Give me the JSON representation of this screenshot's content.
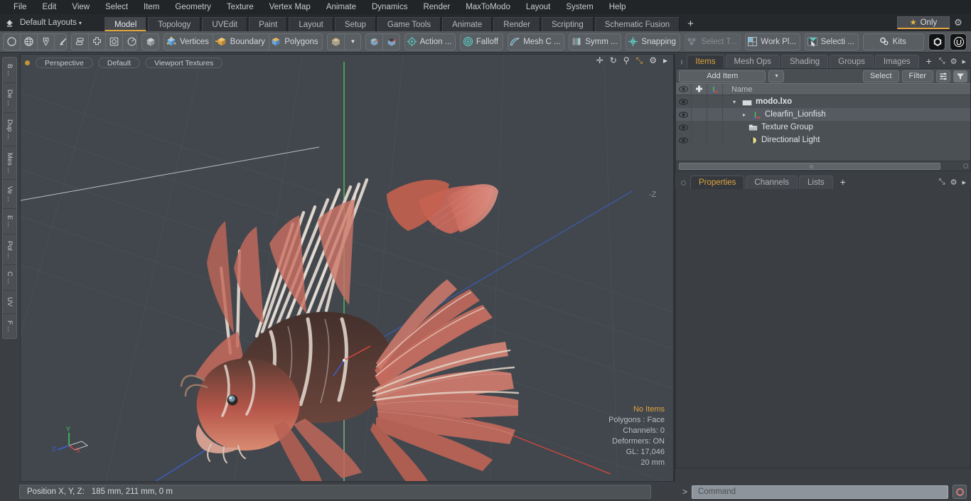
{
  "app": {
    "title": "Modo 3D Modeling Application",
    "accent": "#e0a33c",
    "panel_bg": "#3b3f44",
    "toolbar_bg": "#55595e"
  },
  "menubar": {
    "items": [
      {
        "label": "File"
      },
      {
        "label": "Edit"
      },
      {
        "label": "View"
      },
      {
        "label": "Select"
      },
      {
        "label": "Item"
      },
      {
        "label": "Geometry"
      },
      {
        "label": "Texture"
      },
      {
        "label": "Vertex Map"
      },
      {
        "label": "Animate"
      },
      {
        "label": "Dynamics"
      },
      {
        "label": "Render"
      },
      {
        "label": "MaxToModo"
      },
      {
        "label": "Layout"
      },
      {
        "label": "System"
      },
      {
        "label": "Help"
      }
    ]
  },
  "layoutbar": {
    "home_icon": "home-up-icon",
    "layouts_label": "Default Layouts",
    "caret": "▾",
    "tabs": [
      {
        "label": "Model",
        "active": true
      },
      {
        "label": "Topology",
        "active": false
      },
      {
        "label": "UVEdit",
        "active": false
      },
      {
        "label": "Paint",
        "active": false
      },
      {
        "label": "Layout",
        "active": false
      },
      {
        "label": "Setup",
        "active": false
      },
      {
        "label": "Game Tools",
        "active": false
      },
      {
        "label": "Animate",
        "active": false
      },
      {
        "label": "Render",
        "active": false
      },
      {
        "label": "Scripting",
        "active": false
      },
      {
        "label": "Schematic Fusion",
        "active": false
      }
    ],
    "add_tab_label": "+",
    "only_label": "Only",
    "star_icon": "star-icon",
    "gear_icon": "gear-icon"
  },
  "toolbar": {
    "groups": [
      {
        "name": "primitives",
        "buttons": [
          {
            "icon": "circle-icon",
            "label": ""
          },
          {
            "icon": "globe-icon",
            "label": ""
          },
          {
            "icon": "pen-icon",
            "label": ""
          },
          {
            "icon": "cone-arrow-icon",
            "label": ""
          }
        ]
      },
      {
        "name": "transform-modes",
        "buttons": [
          {
            "icon": "stack-icon",
            "label": ""
          },
          {
            "icon": "move-cross-icon",
            "label": ""
          },
          {
            "icon": "square-dot-icon",
            "label": ""
          },
          {
            "icon": "rotate-circle-icon",
            "label": ""
          }
        ]
      },
      {
        "name": "item-mode",
        "buttons": [
          {
            "icon": "cube-grey-icon",
            "label": ""
          }
        ]
      },
      {
        "name": "selection-modes",
        "buttons": [
          {
            "icon": "vertices-cube-icon",
            "label": "Vertices"
          },
          {
            "icon": "boundary-cube-icon",
            "label": "Boundary"
          },
          {
            "icon": "polygons-cube-icon",
            "label": "Polygons"
          }
        ]
      },
      {
        "name": "item-selector",
        "buttons": [
          {
            "icon": "cube-gold-icon",
            "label": ""
          },
          {
            "icon": "dropdown-caret-icon",
            "label": ""
          }
        ]
      },
      {
        "name": "cube-pair",
        "buttons": [
          {
            "icon": "cube-axis-red-icon",
            "label": ""
          },
          {
            "icon": "cube-axis-dark-icon",
            "label": ""
          }
        ]
      },
      {
        "name": "action-center",
        "buttons": [
          {
            "icon": "target-icon",
            "label": "Action   ..."
          }
        ]
      },
      {
        "name": "falloff",
        "buttons": [
          {
            "icon": "falloff-icon",
            "label": "Falloff"
          }
        ]
      },
      {
        "name": "mesh-constraint",
        "buttons": [
          {
            "icon": "mesh-constraint-icon",
            "label": "Mesh C ..."
          }
        ]
      },
      {
        "name": "symmetry",
        "buttons": [
          {
            "icon": "symmetry-icon",
            "label": "Symm ..."
          }
        ]
      },
      {
        "name": "snapping",
        "buttons": [
          {
            "icon": "snapping-icon",
            "label": "Snapping"
          }
        ]
      },
      {
        "name": "select-through",
        "buttons": [
          {
            "icon": "select-through-icon",
            "label": "Select T...",
            "disabled": true
          }
        ]
      },
      {
        "name": "work-plane",
        "buttons": [
          {
            "icon": "work-plane-icon",
            "label": "Work Pl..."
          }
        ]
      },
      {
        "name": "selection-set",
        "buttons": [
          {
            "icon": "selection-arrow-icon",
            "label": "Selecti ..."
          }
        ]
      },
      {
        "name": "kits",
        "buttons": [
          {
            "icon": "kits-gears-icon",
            "label": "Kits"
          }
        ]
      },
      {
        "name": "engines",
        "buttons": [
          {
            "icon": "unity-cube-icon",
            "label": ""
          },
          {
            "icon": "unreal-engine-icon",
            "label": ""
          }
        ]
      }
    ]
  },
  "left_strip": {
    "tabs": [
      {
        "label": "B ..."
      },
      {
        "label": "De ..."
      },
      {
        "label": "Dup ..."
      },
      {
        "label": "Mes ..."
      },
      {
        "label": "Ve ..."
      },
      {
        "label": "E ..."
      },
      {
        "label": "Pol ..."
      },
      {
        "label": "C ..."
      },
      {
        "label": "UV"
      },
      {
        "label": "F ..."
      }
    ]
  },
  "viewport": {
    "dot_color": "#c79433",
    "pills": [
      {
        "label": "Perspective"
      },
      {
        "label": "Default"
      },
      {
        "label": "Viewport Textures"
      }
    ],
    "header_icons": [
      {
        "name": "pan-icon",
        "glyph": "✛"
      },
      {
        "name": "rotate-icon",
        "glyph": "↻"
      },
      {
        "name": "zoom-icon",
        "glyph": "⚲"
      },
      {
        "name": "fit-icon",
        "glyph": "⤡"
      },
      {
        "name": "viewport-settings-gear-icon",
        "glyph": "⚙"
      },
      {
        "name": "viewport-menu-arrow-icon",
        "glyph": "▸"
      }
    ],
    "axis_label_z": "-Z",
    "gizmo": {
      "x": "X",
      "y": "Y",
      "z": "Z"
    },
    "stats": [
      {
        "label": "No Items",
        "highlight": true
      },
      {
        "label": "Polygons : Face",
        "highlight": false
      },
      {
        "label": "Channels: 0",
        "highlight": false
      },
      {
        "label": "Deformers: ON",
        "highlight": false
      },
      {
        "label": "GL: 17,046",
        "highlight": false
      },
      {
        "label": "20 mm",
        "highlight": false
      }
    ],
    "model": {
      "name": "Clearfin Lionfish",
      "body_color": "#c4584a",
      "fin_color": "#cf7b6e",
      "spine_color": "#ddd2c8",
      "stripe_color": "#4b332e"
    }
  },
  "items_panel": {
    "tabs": [
      {
        "label": "Items",
        "active": true
      },
      {
        "label": "Mesh Ops",
        "active": false
      },
      {
        "label": "Shading",
        "active": false
      },
      {
        "label": "Groups",
        "active": false
      },
      {
        "label": "Images",
        "active": false
      }
    ],
    "add_tab_label": "+",
    "header_icons": [
      {
        "name": "expand-panel-icon",
        "glyph": "⤡"
      },
      {
        "name": "panel-gear-icon",
        "glyph": "⚙"
      },
      {
        "name": "panel-arrow-icon",
        "glyph": "▸"
      }
    ],
    "add_item_label": "Add Item",
    "add_item_caret": "▾",
    "select_label": "Select",
    "filter_label": "Filter",
    "list_options_icon": "list-options-icon",
    "filter_funnel_icon": "funnel-icon",
    "columns": [
      {
        "name": "visibility-column",
        "icon": "eye-icon"
      },
      {
        "name": "lock-column",
        "icon": "plus-cross-icon"
      },
      {
        "name": "axis-column",
        "icon": "axis-icon"
      },
      {
        "name": "name-column",
        "label": "Name"
      }
    ],
    "tree": [
      {
        "label": "modo.lxo",
        "icon": "scene-clapper-icon",
        "depth": 0,
        "bold": true,
        "twisty": "▾",
        "selected": false
      },
      {
        "label": "Clearfin_Lionfish",
        "icon": "mesh-axis-icon",
        "depth": 1,
        "bold": false,
        "twisty": "▸",
        "selected": true
      },
      {
        "label": "Texture Group",
        "icon": "folder-icon",
        "depth": 1,
        "bold": false,
        "twisty": "",
        "selected": false
      },
      {
        "label": "Directional Light",
        "icon": "light-icon",
        "depth": 1,
        "bold": false,
        "twisty": "",
        "selected": false
      }
    ]
  },
  "properties_panel": {
    "tabs": [
      {
        "label": "Properties",
        "active": true
      },
      {
        "label": "Channels",
        "active": false
      },
      {
        "label": "Lists",
        "active": false
      }
    ],
    "add_tab_label": "+",
    "header_icons": [
      {
        "name": "expand-panel-icon",
        "glyph": "⤡"
      },
      {
        "name": "panel-gear-icon",
        "glyph": "⚙"
      },
      {
        "name": "panel-arrow-icon",
        "glyph": "▸"
      }
    ]
  },
  "statusbar": {
    "position_label": "Position X, Y, Z:",
    "position_value": "185 mm, 211 mm, 0 m"
  },
  "commandbar": {
    "chevron": ">",
    "placeholder": "Command",
    "value": "",
    "stop_icon": "stop-circle-icon"
  }
}
